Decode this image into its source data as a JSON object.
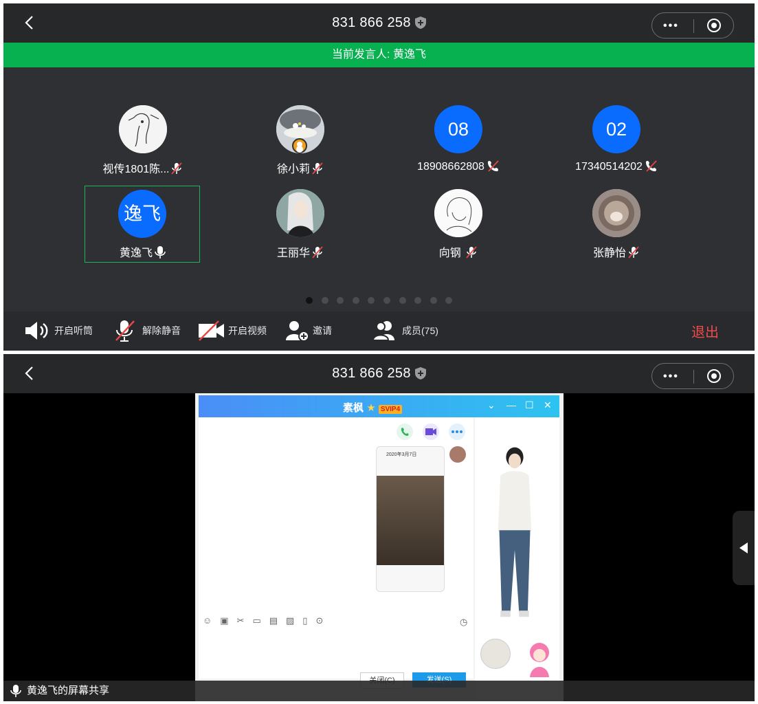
{
  "meeting": {
    "id": "831 866 258",
    "current_speaker": "当前发言人: 黄逸飞"
  },
  "participants": [
    {
      "name": "视传1801陈...",
      "avatar_type": "photo",
      "muted": true
    },
    {
      "name": "徐小莉",
      "avatar_type": "photo",
      "muted": true,
      "host": true
    },
    {
      "name": "18908662808",
      "avatar_type": "initials",
      "initials": "08",
      "muted": true,
      "phone": true
    },
    {
      "name": "17340514202",
      "avatar_type": "initials",
      "initials": "02",
      "muted": true,
      "phone": true
    },
    {
      "name": "黄逸飞",
      "avatar_type": "initials",
      "initials": "逸飞",
      "muted": false,
      "speaking": true
    },
    {
      "name": "王丽华",
      "avatar_type": "photo",
      "muted": true
    },
    {
      "name": "向钢",
      "avatar_type": "photo",
      "muted": true
    },
    {
      "name": "张静怡",
      "avatar_type": "photo",
      "muted": true
    }
  ],
  "pager": {
    "pages": 10,
    "current": 1
  },
  "toolbar": {
    "speaker": "开启听筒",
    "unmute": "解除静音",
    "video": "开启视频",
    "invite": "邀请",
    "members": "成员(75)",
    "exit": "退出"
  },
  "share": {
    "window_title": "素枫",
    "badge": "SVIP4",
    "close_btn": "关闭(C)",
    "send_btn": "发送(S)",
    "phone_date": "2020年3月7日",
    "label": "黄逸飞的屏幕共享"
  },
  "colors": {
    "accent_green": "#07b150",
    "avatar_blue": "#0a6cff",
    "exit_red": "#f24b4b"
  }
}
